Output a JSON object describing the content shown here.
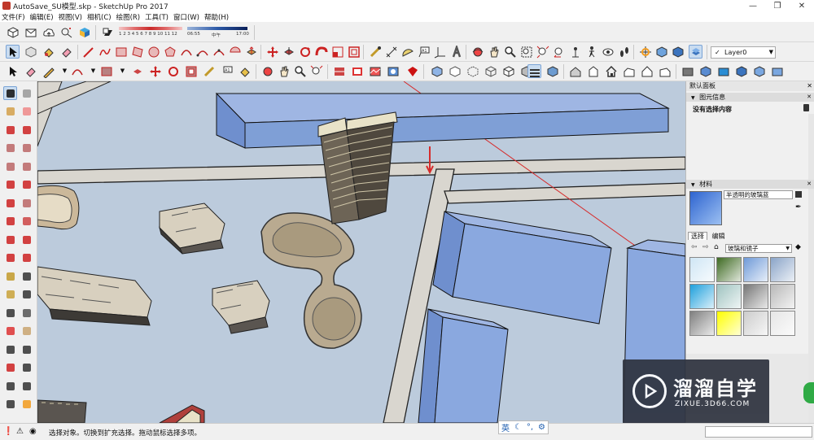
{
  "window": {
    "title": "AutoSave_SU模型.skp - SketchUp Pro 2017",
    "controls": [
      "—",
      "❐",
      "✕"
    ]
  },
  "menu": [
    "文件(F)",
    "编辑(E)",
    "视图(V)",
    "相机(C)",
    "绘图(R)",
    "工具(T)",
    "窗口(W)",
    "帮助(H)"
  ],
  "shadow_toolbar": {
    "months": "1 2 3 4 5 6 7 8 9 10 11 12",
    "time_start": "06:55",
    "time_mid": "中午",
    "time_end": "17:00"
  },
  "layer_select": {
    "value": "Layer0"
  },
  "default_panel": {
    "title": "默认面板",
    "entity_info": {
      "header": "图元信息",
      "value": "没有选择内容"
    },
    "materials": {
      "header": "材料",
      "current_name": "半透明的玻璃蓝",
      "tabs": [
        "选择",
        "编辑"
      ],
      "library": "玻璃和镜子",
      "swatch_colors": [
        "#cfe6f5",
        "#3e6a22",
        "#6f9ad8",
        "#8aa4c8",
        "#1ea0dc",
        "#9fc3c0",
        "#777777",
        "#b8b8b8",
        "#7f7f7f",
        "#ffff00",
        "#cccccc",
        "#e6e6e6"
      ]
    },
    "measurements_label": "数值"
  },
  "status": {
    "hint": "选择对象。切换到扩充选择。拖动鼠标选择多项。",
    "ime": [
      "英",
      "☾",
      "°,",
      "⚙"
    ]
  },
  "watermark": {
    "brand": "溜溜自学",
    "url": "ZIXUE.3D66.COM"
  },
  "colors": {
    "ground": "#bccbdc",
    "road": "#d9d6cf",
    "glass": "#7f9fd6",
    "accent_red": "#d62b2b"
  }
}
